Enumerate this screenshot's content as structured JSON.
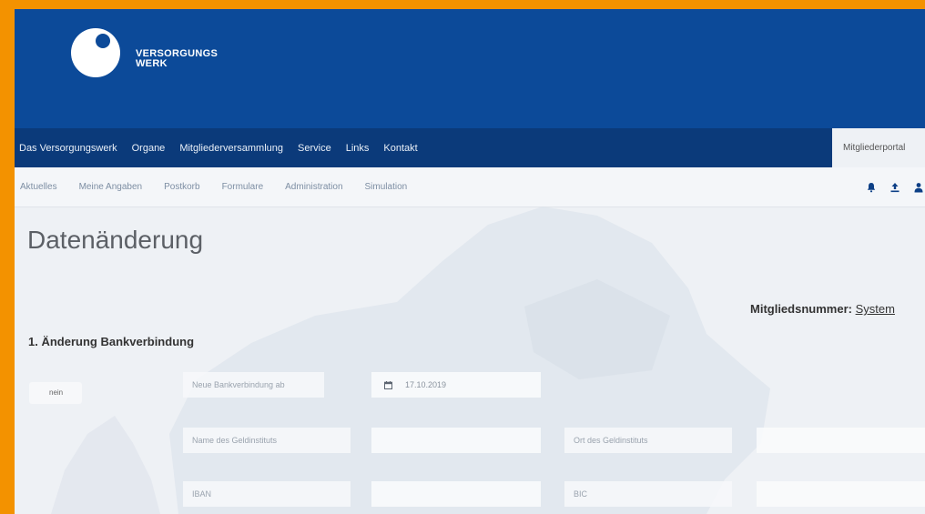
{
  "brand": {
    "line1": "VERSORGUNGS",
    "line2": "WERK"
  },
  "top_nav": {
    "items": [
      "Das Versorgungswerk",
      "Organe",
      "Mitgliederversammlung",
      "Service",
      "Links",
      "Kontakt"
    ],
    "portal": "Mitgliederportal"
  },
  "sub_nav": {
    "items": [
      "Aktuelles",
      "Meine Angaben",
      "Postkorb",
      "Formulare",
      "Administration",
      "Simulation"
    ],
    "icons": [
      "bell-icon",
      "upload-icon",
      "user-icon"
    ]
  },
  "page": {
    "title": "Datenänderung",
    "member_label": "Mitgliedsnummer:",
    "member_value": "System"
  },
  "section": {
    "title": "1. Änderung Bankverbindung",
    "toggle_label": "nein",
    "fields": {
      "new_bank_label": "Neue Bankverbindung ab",
      "date_value": "17.10.2019",
      "bank_name_label": "Name des Geldinstituts",
      "bank_location_label": "Ort des Geldinstituts",
      "iban_label": "IBAN",
      "bic_label": "BIC"
    }
  },
  "colors": {
    "header_blue": "#0c4a99",
    "nav_blue": "#0b3a7a",
    "frame_orange": "#f39200"
  }
}
